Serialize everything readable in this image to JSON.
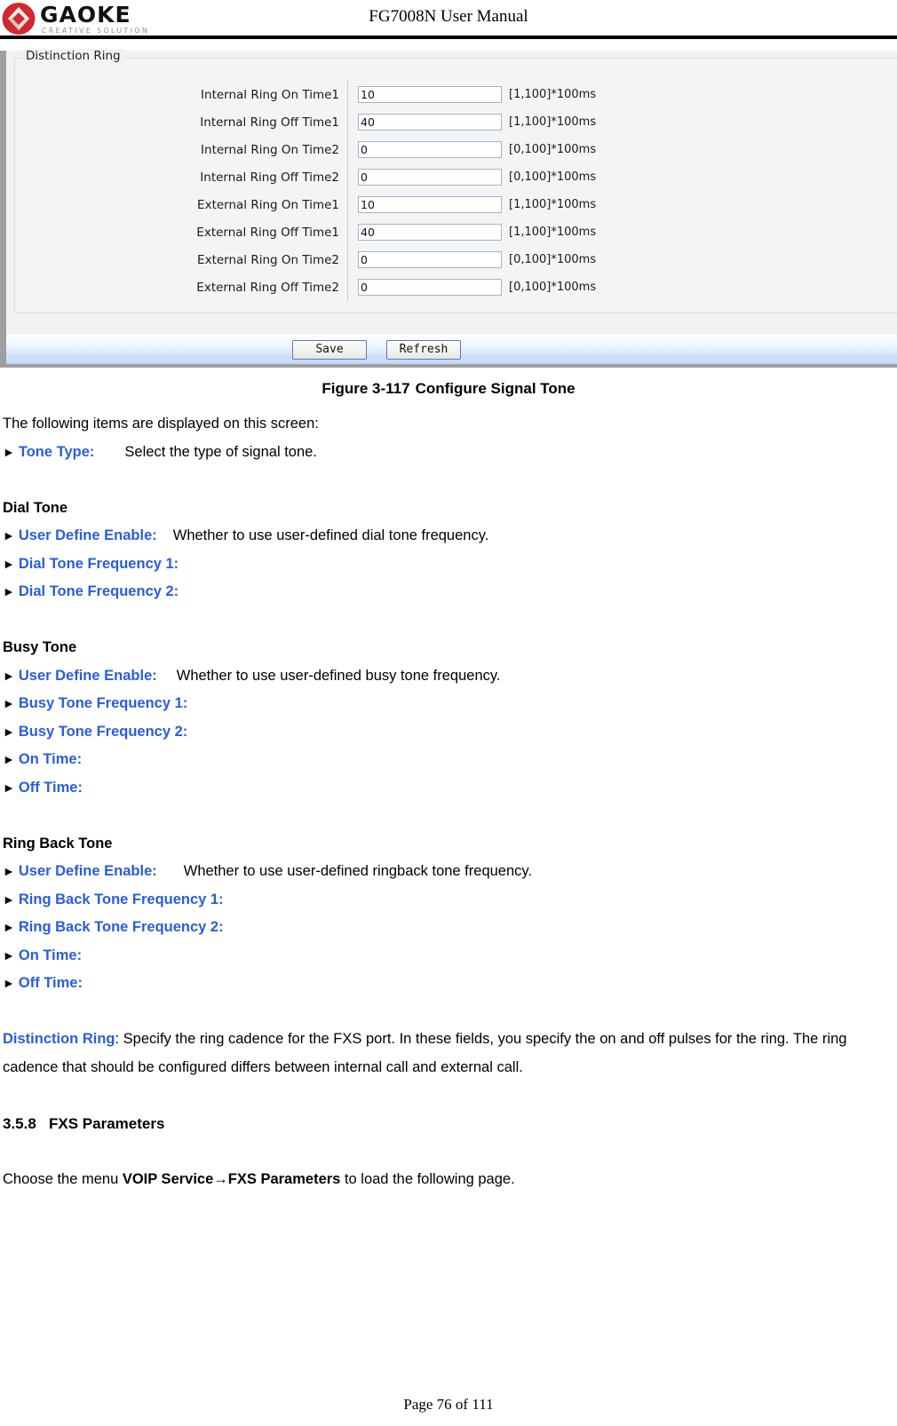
{
  "header": {
    "logo_word": "GAOKE",
    "logo_tagline": "CREATIVE SOLUTION",
    "title": "FG7008N User Manual"
  },
  "screenshot": {
    "legend": "Distinction Ring",
    "rows": [
      {
        "label": "Internal Ring On Time1",
        "value": "10",
        "hint": "[1,100]*100ms"
      },
      {
        "label": "Internal Ring Off Time1",
        "value": "40",
        "hint": "[1,100]*100ms"
      },
      {
        "label": "Internal Ring On Time2",
        "value": "0",
        "hint": "[0,100]*100ms"
      },
      {
        "label": "Internal Ring Off Time2",
        "value": "0",
        "hint": "[0,100]*100ms"
      },
      {
        "label": "External Ring On Time1",
        "value": "10",
        "hint": "[1,100]*100ms"
      },
      {
        "label": "External Ring Off Time1",
        "value": "40",
        "hint": "[1,100]*100ms"
      },
      {
        "label": "External Ring On Time2",
        "value": "0",
        "hint": "[0,100]*100ms"
      },
      {
        "label": "External Ring Off Time2",
        "value": "0",
        "hint": "[0,100]*100ms"
      }
    ],
    "save_label": "Save",
    "refresh_label": "Refresh"
  },
  "figure": {
    "number": "Figure 3-117",
    "caption": "Configure Signal Tone"
  },
  "body": {
    "intro": "The following items are displayed on this screen:",
    "tone_type_term": "Tone Type:",
    "tone_type_desc": "Select the type of signal tone.",
    "dial_tone_head": "Dial Tone",
    "dial_user_define_term": "User Define Enable:",
    "dial_user_define_desc": "Whether to use user-defined dial tone frequency.",
    "dial_freq1_term": "Dial Tone Frequency 1:",
    "dial_freq2_term": "Dial Tone Frequency 2:",
    "busy_tone_head": "Busy Tone",
    "busy_user_define_term": "User Define Enable:",
    "busy_user_define_desc": "Whether to use user-defined busy tone frequency.",
    "busy_freq1_term": "Busy Tone Frequency 1:",
    "busy_freq2_term": "Busy Tone Frequency 2:",
    "busy_on_time_term": "On Time:",
    "busy_off_time_term": "Off Time:",
    "ringback_head": "Ring Back Tone",
    "ringback_user_define_term": "User Define Enable:",
    "ringback_user_define_desc": "Whether to use user-defined ringback tone frequency.",
    "ringback_freq1_term": "Ring Back Tone Frequency 1:",
    "ringback_freq2_term": "Ring Back Tone Frequency 2:",
    "ringback_on_time_term": "On Time:",
    "ringback_off_time_term": "Off Time:",
    "distinction_term": "Distinction Ring",
    "distinction_desc": ": Specify the ring cadence for the FXS port. In these fields, you specify the on and off pulses for the ring. The ring cadence that should be configured differs between internal call and external call.",
    "section_number": "3.5.8",
    "section_title": "FXS Parameters",
    "choose_prefix": "Choose the menu ",
    "choose_menu": "VOIP Service→FXS Parameters",
    "choose_suffix": " to load the following page.",
    "arrow_glyph": "►"
  },
  "footer": {
    "page_label": "Page 76 of 111"
  }
}
